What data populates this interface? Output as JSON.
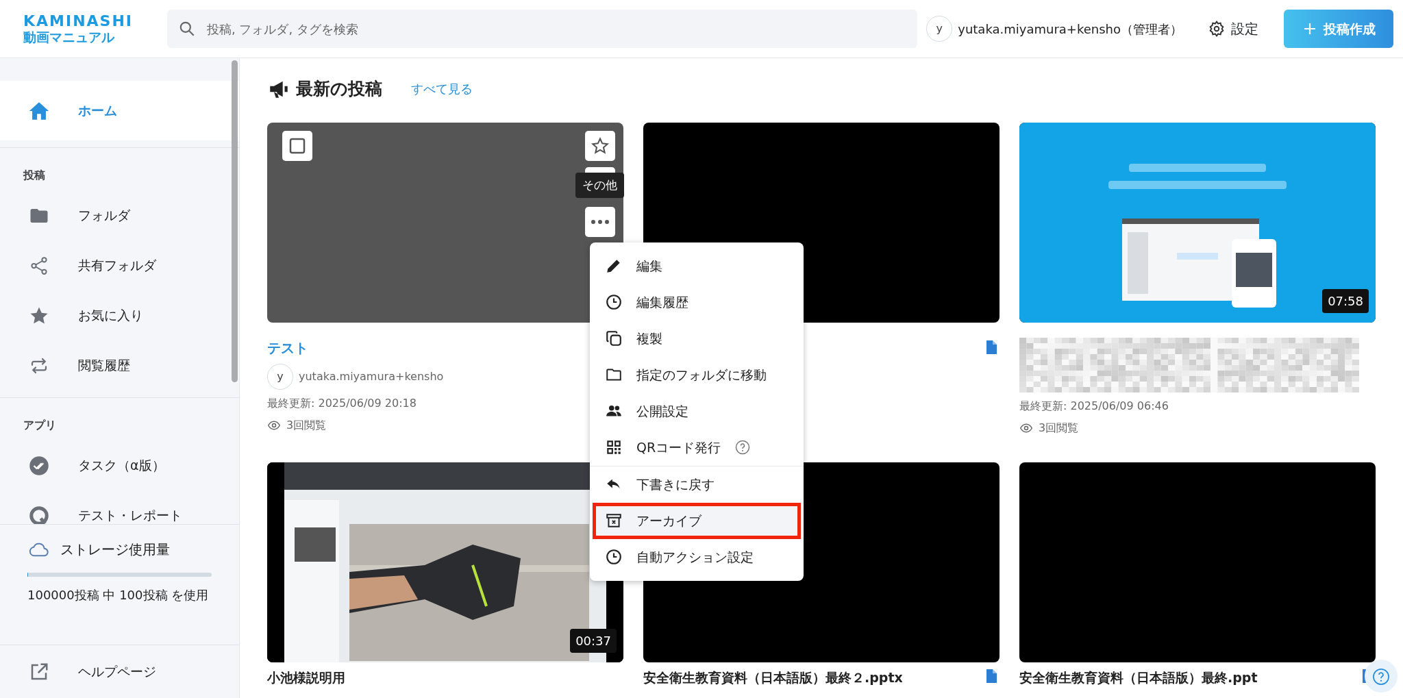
{
  "header": {
    "logo_line1": "KAMINASHI",
    "logo_line2": "動画マニュアル",
    "search": {
      "placeholder": "投稿, フォルダ, タグを検索"
    },
    "user": {
      "avatar": "y",
      "name": "yutaka.miyamura+kensho（管理者）"
    },
    "settings": "設定",
    "create_button": "投稿作成"
  },
  "sidebar": {
    "home": {
      "label": "ホーム",
      "selected": true
    },
    "sections": [
      {
        "title": "投稿",
        "items": [
          {
            "label": "フォルダ",
            "selected": false
          },
          {
            "label": "共有フォルダ",
            "selected": false
          },
          {
            "label": "お気に入り",
            "selected": false
          },
          {
            "label": "閲覧履歴",
            "selected": false
          }
        ]
      },
      {
        "title": "アプリ",
        "items": [
          {
            "label": "タスク（α版）",
            "selected": false
          },
          {
            "label": "テスト・レポート",
            "selected": false
          }
        ]
      }
    ],
    "storage": {
      "title": "ストレージ使用量",
      "level": 0.001,
      "usage": "100000投稿 中 100投稿 を使用"
    },
    "help": "ヘルプページ"
  },
  "main": {
    "title": "最新の投稿",
    "see_all": "すべて見る",
    "posts": [
      {
        "kind": "video",
        "hovered": true,
        "title": "テスト",
        "avatar": "y",
        "author": "yutaka.miyamura+kensho",
        "updated": "最終更新: 2025/06/09 20:18",
        "views": "3回閲覧",
        "checked": false,
        "favorite": false
      },
      {
        "kind": "document",
        "hovered": false
      },
      {
        "kind": "video",
        "hovered": false,
        "duration": "07:58",
        "author_blurred": true,
        "updated": "最終更新: 2025/06/09 06:46",
        "views": "3回閲覧"
      },
      {
        "kind": "video",
        "hovered": false,
        "duration": "00:37",
        "title": "小池様説明用"
      },
      {
        "kind": "document",
        "hovered": false,
        "title": "安全衛生教育資料（日本語版）最終２.pptx"
      },
      {
        "kind": "document",
        "hovered": false,
        "title": "安全衛生教育資料（日本語版）最終.ppt"
      }
    ],
    "tooltip": "その他",
    "menu": [
      {
        "label": "編集",
        "divider_before": false,
        "highlighted": false,
        "help": false
      },
      {
        "label": "編集履歴",
        "divider_before": false,
        "highlighted": false,
        "help": false
      },
      {
        "label": "複製",
        "divider_before": false,
        "highlighted": false,
        "help": false
      },
      {
        "label": "指定のフォルダに移動",
        "divider_before": false,
        "highlighted": false,
        "help": false
      },
      {
        "label": "公開設定",
        "divider_before": false,
        "highlighted": false,
        "help": false
      },
      {
        "label": "QRコード発行",
        "divider_before": false,
        "highlighted": false,
        "help": true
      },
      {
        "label": "下書きに戻す",
        "divider_before": true,
        "highlighted": false,
        "help": false
      },
      {
        "label": "アーカイブ",
        "divider_before": false,
        "highlighted": true,
        "help": false
      },
      {
        "label": "自動アクション設定",
        "divider_before": false,
        "highlighted": false,
        "help": false
      }
    ]
  }
}
